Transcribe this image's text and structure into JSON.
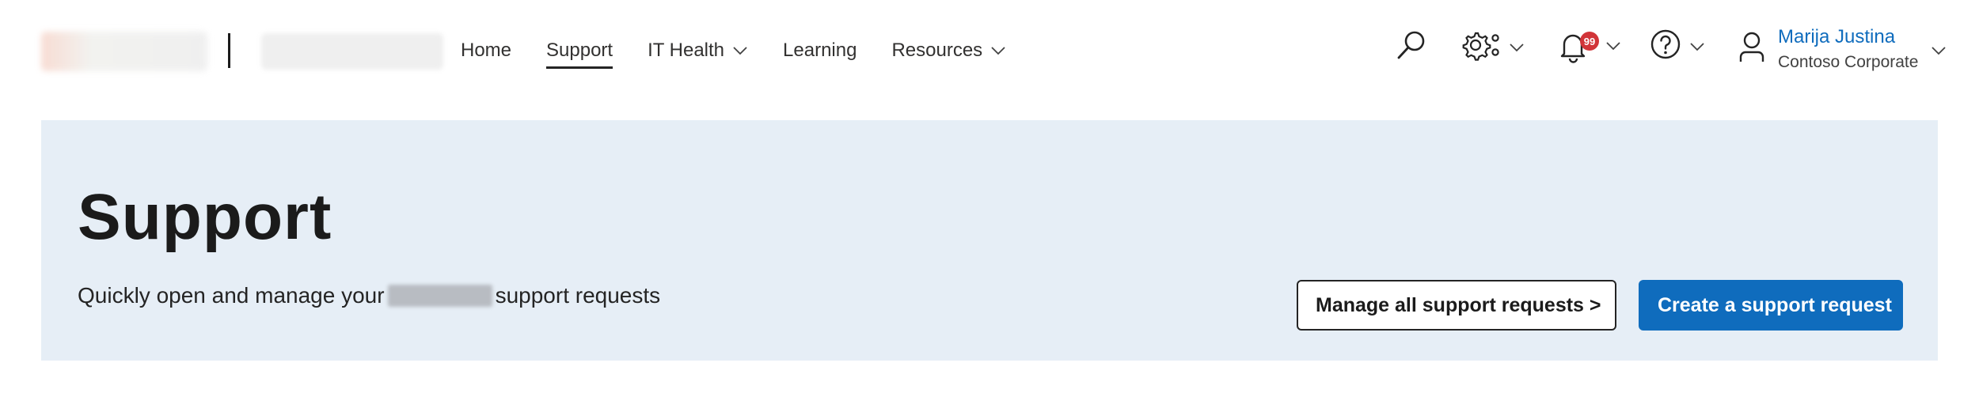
{
  "nav": {
    "items": [
      {
        "label": "Home",
        "has_dropdown": false,
        "active": false
      },
      {
        "label": "Support",
        "has_dropdown": false,
        "active": true
      },
      {
        "label": "IT Health",
        "has_dropdown": true,
        "active": false
      },
      {
        "label": "Learning",
        "has_dropdown": false,
        "active": false
      },
      {
        "label": "Resources",
        "has_dropdown": true,
        "active": false
      }
    ]
  },
  "header_icons": {
    "search": "search-icon",
    "settings": "gear-icon",
    "notifications": "bell-icon",
    "notification_count": "99",
    "help": "help-icon"
  },
  "user": {
    "name": "Marija Justina",
    "org": "Contoso Corporate"
  },
  "hero": {
    "title": "Support",
    "subtitle_before": "Quickly open and manage your",
    "subtitle_after": "support requests",
    "manage_button": "Manage all support requests >",
    "create_button": "Create a support request"
  },
  "colors": {
    "accent": "#0f6cbd",
    "hero_background": "#e6eef6",
    "badge": "#d13438"
  }
}
